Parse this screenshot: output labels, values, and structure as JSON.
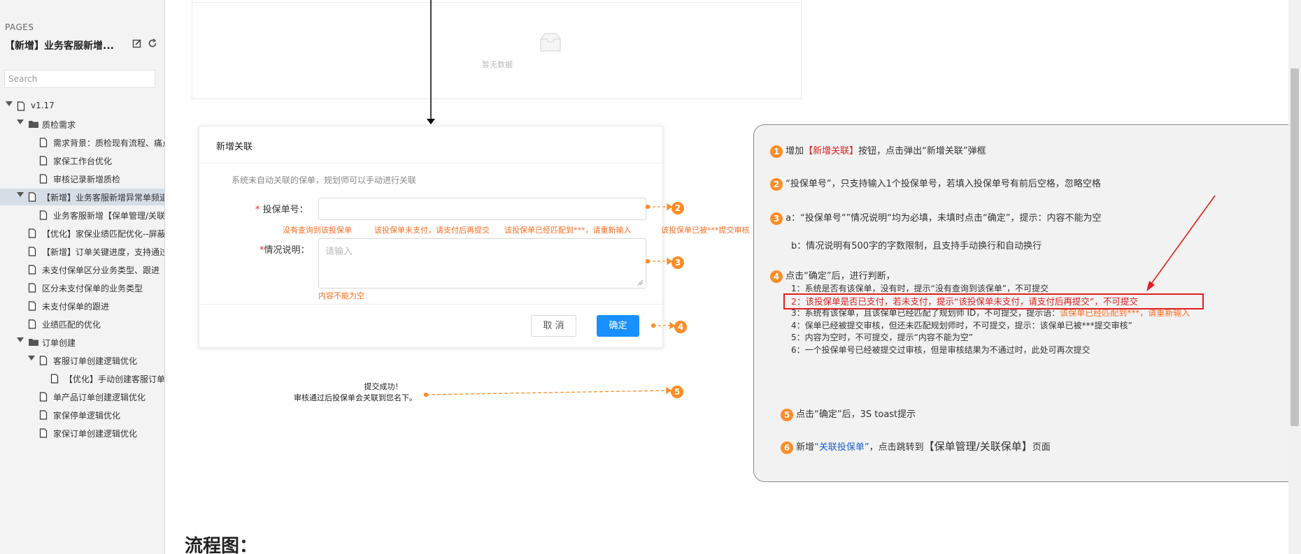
{
  "sidebar": {
    "section_label": "PAGES",
    "doc_title": "【新增】业务客服新增...",
    "search_placeholder": "Search",
    "tree": [
      {
        "label": "v1.17",
        "icon": "page",
        "caret": true
      },
      {
        "label": "质检需求",
        "icon": "folder",
        "caret": true
      },
      {
        "label": "需求背景：质检现有流程、痛点",
        "icon": "page"
      },
      {
        "label": "家保工作台优化",
        "icon": "page"
      },
      {
        "label": "审核记录新增质检",
        "icon": "page"
      },
      {
        "label": "【新增】业务客服新增异常单频道",
        "icon": "page",
        "caret": true,
        "selected": true
      },
      {
        "label": "业务客服新增【保单管理/关联】",
        "icon": "page"
      },
      {
        "label": "【优化】家保业绩匹配优化--屏蔽",
        "icon": "page"
      },
      {
        "label": "【新增】订单关键进度，支持通过",
        "icon": "page"
      },
      {
        "label": "未支付保单区分业务类型、跟进",
        "icon": "page"
      },
      {
        "label": "区分未支付保单的业务类型",
        "icon": "page"
      },
      {
        "label": "未支付保单的跟进",
        "icon": "page"
      },
      {
        "label": "业绩匹配的优化",
        "icon": "page"
      },
      {
        "label": "订单创建",
        "icon": "folder",
        "caret": true
      },
      {
        "label": "客服订单创建逻辑优化",
        "icon": "page",
        "caret": true
      },
      {
        "label": "【优化】手动创建客服订单",
        "icon": "page"
      },
      {
        "label": "单产品订单创建逻辑优化",
        "icon": "page"
      },
      {
        "label": "家保停单逻辑优化",
        "icon": "page"
      },
      {
        "label": "家保订单创建逻辑优化",
        "icon": "page"
      }
    ]
  },
  "top_panel": {
    "empty_text": "暂无数据"
  },
  "dialog": {
    "title": "新增关联",
    "hint": "系统未自动关联的保单，规划师可以手动进行关联",
    "policy_label": "投保单号：",
    "policy_required": "*",
    "policy_value": "",
    "errors": [
      "没有查询到该投保单",
      "该投保单未支付，请支付后再提交",
      "该投保单已经匹配到***，请重新输入",
      "该投保单已被***提交审核"
    ],
    "desc_label": "情况说明：",
    "desc_required": "*",
    "desc_placeholder": "请输入",
    "desc_error": "内容不能为空",
    "cancel": "取 消",
    "confirm": "确定"
  },
  "markers": [
    "2",
    "3",
    "4",
    "5"
  ],
  "toast": {
    "line1": "提交成功！",
    "line2": "审核通过后投保单会关联到您名下。"
  },
  "annotations": {
    "a1": {
      "num": "1",
      "pre": "增加",
      "highlight": "【新增关联】",
      "post": "按钮，点击弹出“新增关联”弹框"
    },
    "a2": {
      "num": "2",
      "text": "“投保单号”，只支持输入1个投保单号，若填入投保单号有前后空格，忽略空格"
    },
    "a3": {
      "num": "3",
      "line_a": "a：“投保单号“”情况说明“均为必填，未填时点击“确定”，提示：内容不能为空",
      "line_b": "b：情况说明有500字的字数限制，且支持手动换行和自动换行"
    },
    "a4": {
      "num": "4",
      "intro": "点击“确定”后，进行判断，",
      "items": [
        "1：系统是否有该保单，没有时，提示“没有查询到该保单”，不可提交",
        "2：该投保单是否已支付，若未支付，提示“该投保单未支付，请支付后再提交”，不可提交",
        "3：系统有该保单，且该保单已经匹配了规划师 ID，不可提交，提示语：",
        "4：保单已经被提交审核，但还未匹配规划师时，不可提交，提示：该保单已被***提交审核”",
        "5：内容为空时，不可提交，提示“内容不能为空”",
        "6：一个投保单号已经被提交过审核，但是审核结果为不通过时，此处可再次提交"
      ],
      "item3_hint": "该保单已经匹配到***，请重新输入"
    },
    "a5": {
      "num": "5",
      "text": "点击“确定”后，3S toast提示"
    },
    "a6": {
      "num": "6",
      "pre": "新增",
      "link": "“关联投保单”",
      "mid": "，点击跳转到",
      "big": "【保单管理/关联保单】",
      "post": "页面"
    }
  },
  "heading": "流程图：",
  "colors": {
    "accent": "#ff8c26",
    "primary": "#1890ff",
    "danger": "#e02020",
    "link": "#1a5fd1"
  }
}
